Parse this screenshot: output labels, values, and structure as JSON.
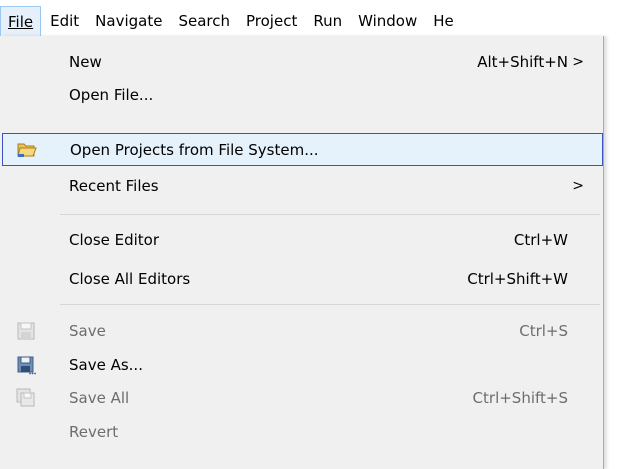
{
  "menubar": {
    "items": [
      {
        "label": "File",
        "active": true
      },
      {
        "label": "Edit"
      },
      {
        "label": "Navigate"
      },
      {
        "label": "Search"
      },
      {
        "label": "Project"
      },
      {
        "label": "Run"
      },
      {
        "label": "Window"
      },
      {
        "label": "He"
      }
    ]
  },
  "file_menu": {
    "items": [
      {
        "label": "New",
        "accelerator": "Alt+Shift+N",
        "submenu": true
      },
      {
        "label": "Open File..."
      },
      {
        "label": "Open Projects from File System...",
        "icon": "folder-open-icon",
        "highlighted": true
      },
      {
        "label": "Recent Files",
        "submenu": true
      },
      {
        "label": "Close Editor",
        "accelerator": "Ctrl+W"
      },
      {
        "label": "Close All Editors",
        "accelerator": "Ctrl+Shift+W"
      },
      {
        "label": "Save",
        "accelerator": "Ctrl+S",
        "icon": "save-icon",
        "disabled": true
      },
      {
        "label": "Save As...",
        "icon": "save-as-icon"
      },
      {
        "label": "Save All",
        "accelerator": "Ctrl+Shift+S",
        "icon": "save-all-icon",
        "disabled": true
      },
      {
        "label": "Revert",
        "disabled": true
      }
    ],
    "submenu_arrow": ">"
  },
  "colors": {
    "highlight_border": "#3d51c0",
    "highlight_bg": "#e5f1fb",
    "menu_bg": "#f0f0f0",
    "disabled_text": "#6d6d6d"
  }
}
